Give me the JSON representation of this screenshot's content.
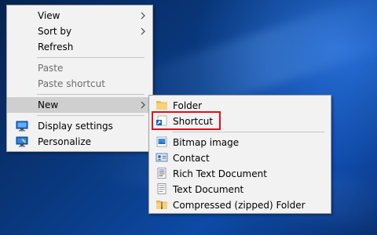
{
  "context_menu": {
    "items": [
      {
        "label": "View"
      },
      {
        "label": "Sort by"
      },
      {
        "label": "Refresh"
      },
      {
        "label": "Paste"
      },
      {
        "label": "Paste shortcut"
      },
      {
        "label": "New"
      },
      {
        "label": "Display settings",
        "icon": "display-settings-icon"
      },
      {
        "label": "Personalize",
        "icon": "personalize-icon"
      }
    ]
  },
  "new_submenu": {
    "items": [
      {
        "label": "Folder",
        "icon": "folder-icon"
      },
      {
        "label": "Shortcut",
        "icon": "shortcut-icon"
      },
      {
        "label": "Bitmap image",
        "icon": "bitmap-image-icon"
      },
      {
        "label": "Contact",
        "icon": "contact-icon"
      },
      {
        "label": "Rich Text Document",
        "icon": "rich-text-document-icon"
      },
      {
        "label": "Text Document",
        "icon": "text-document-icon"
      },
      {
        "label": "Compressed (zipped) Folder",
        "icon": "zip-folder-icon"
      }
    ]
  },
  "colors": {
    "menu_bg": "#f2f2f2",
    "hover_bg": "#cfcfcf",
    "disabled_text": "#6d6d6d",
    "highlight_border": "#e0101c",
    "desktop_blue": "#0a3b84"
  }
}
